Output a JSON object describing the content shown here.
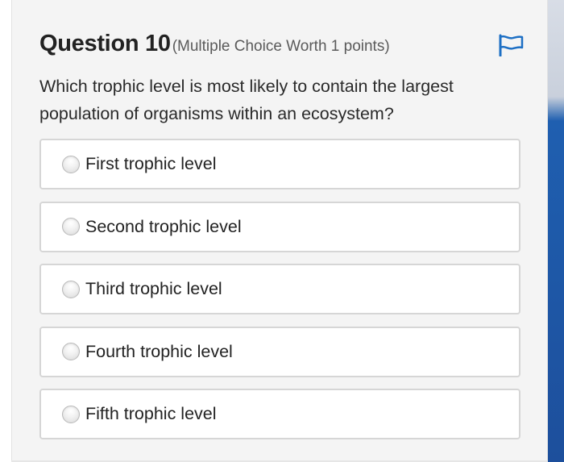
{
  "question": {
    "title": "Question 10",
    "meta": "(Multiple Choice Worth 1 points)",
    "text": "Which trophic level is most likely to contain the largest population of organisms within an ecosystem?",
    "flag_icon": "flag-icon",
    "flag_color": "#1d6fc4"
  },
  "options": [
    {
      "label": "First trophic level",
      "selected": false
    },
    {
      "label": "Second trophic level",
      "selected": false
    },
    {
      "label": "Third trophic level",
      "selected": false
    },
    {
      "label": "Fourth trophic level",
      "selected": false
    },
    {
      "label": "Fifth trophic level",
      "selected": false
    }
  ],
  "colors": {
    "card_background": "#f4f4f4",
    "option_border": "#d6d6d6",
    "accent_blue": "#1d4f9c"
  }
}
